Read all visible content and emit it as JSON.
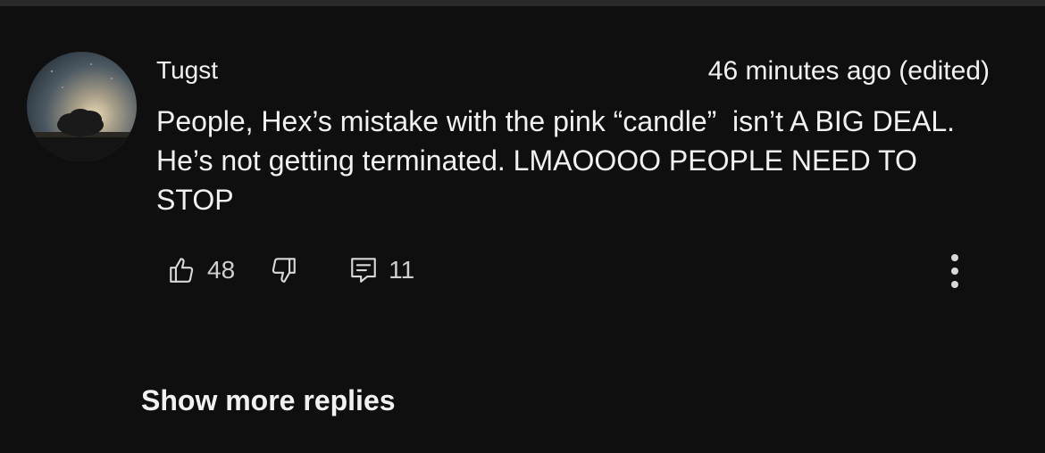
{
  "comment": {
    "author": "Tugst",
    "timestamp": "46 minutes ago (edited)",
    "text": "People, Hex’s mistake with the pink “candle”  isn’t A BIG DEAL. He’s not getting terminated. LMAOOOO PEOPLE NEED TO STOP",
    "avatar_icon": "tree-silhouette-avatar",
    "actions": {
      "like_icon": "thumbs-up-icon",
      "like_count": "48",
      "dislike_icon": "thumbs-down-icon",
      "reply_icon": "reply-comment-icon",
      "reply_count": "11",
      "more_icon": "more-vertical-icon"
    }
  },
  "replies": {
    "show_more_label": "Show more replies"
  },
  "colors": {
    "background": "#0f0f0f",
    "text": "#f1f1f1",
    "secondary_text": "#cfcfcf"
  }
}
